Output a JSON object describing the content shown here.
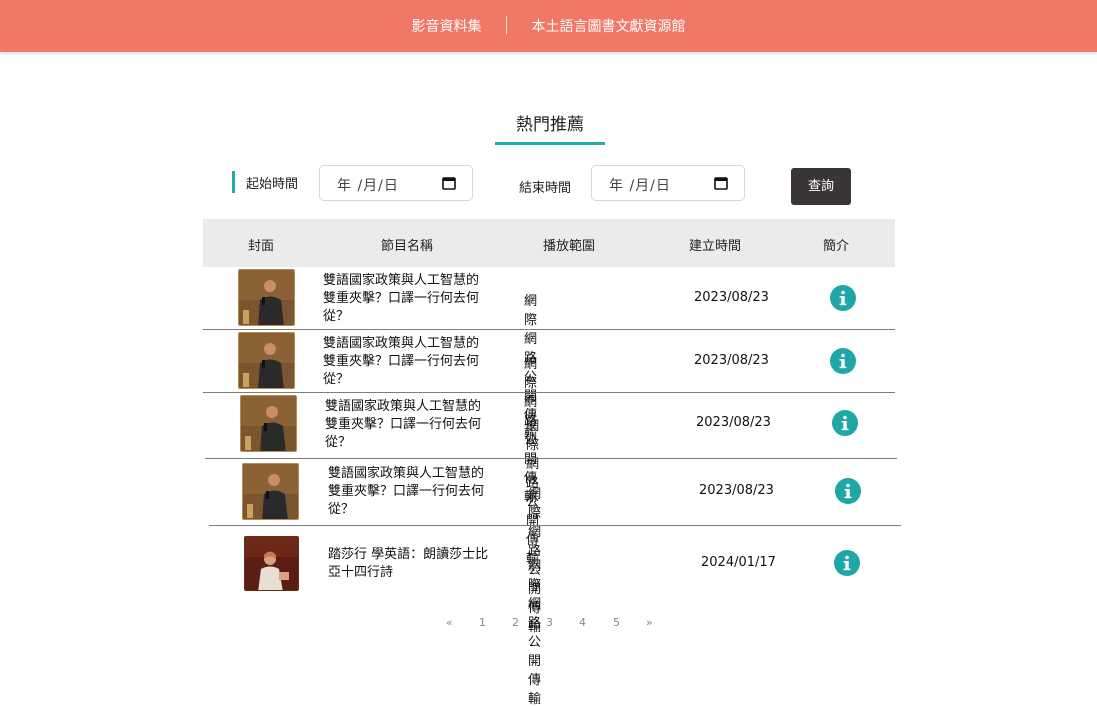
{
  "header": {
    "nav": [
      {
        "label": "影音資料集"
      },
      {
        "label": "本土語言圖書文獻資源館"
      }
    ],
    "background": "#f07866"
  },
  "page_title": "熱門推薦",
  "filters": {
    "start_label": "起始時間",
    "start_value": "年 /月/日",
    "end_label": "結束時間",
    "end_value": "年 /月/日",
    "query_label": "查詢"
  },
  "table": {
    "headers": [
      "封面",
      "節目名稱",
      "播放範圍",
      "建立時間",
      "簡介"
    ],
    "rows": [
      {
        "title_lines": [
          "雙語國家政策與人工智慧的",
          "雙重夾擊？口譯一行何去何",
          "從？"
        ],
        "scope": "網際網路公開傳輸",
        "date": "2023/08/23",
        "cover": "speaker-man-icon"
      },
      {
        "title_lines": [
          "雙語國家政策與人工智慧的",
          "雙重夾擊？口譯一行何去何",
          "從？"
        ],
        "scope": "網際網路公開傳輸",
        "date": "2023/08/23",
        "cover": "speaker-man-icon"
      },
      {
        "title_lines": [
          "雙語國家政策與人工智慧的",
          "雙重夾擊？口譯一行何去何",
          "從？"
        ],
        "scope": "網際網路公開傳輸",
        "date": "2023/08/23",
        "cover": "speaker-man-icon"
      },
      {
        "title_lines": [
          "雙語國家政策與人工智慧的",
          "雙重夾擊？口譯一行何去何",
          "從？"
        ],
        "scope": "網際網路公開傳輸",
        "date": "2023/08/23",
        "cover": "speaker-man-icon"
      },
      {
        "title_lines": [
          "踏莎行 學英語：朗讀莎士比",
          "亞十四行詩"
        ],
        "scope": "網際網路公開傳輸",
        "date": "2024/01/17",
        "cover": "speaker-woman-icon"
      }
    ]
  },
  "pagination": [
    "«",
    "1",
    "2",
    "3",
    "4",
    "5",
    "»"
  ],
  "colors": {
    "accent": "#26a9a9",
    "info": "#1ea7a6",
    "button": "#3a3636"
  }
}
